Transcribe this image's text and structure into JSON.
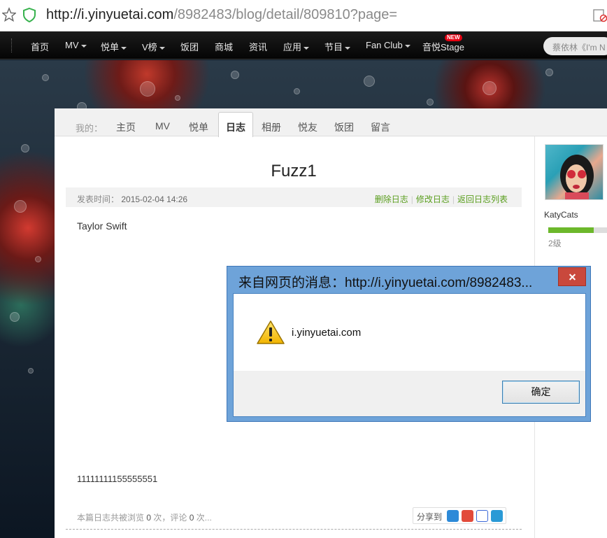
{
  "browser": {
    "url_host": "http://i.yinyuetai.com",
    "url_path": "/8982483/blog/detail/809810?page="
  },
  "topnav": {
    "items": [
      {
        "label": "首页"
      },
      {
        "label": "MV"
      },
      {
        "label": "悦单"
      },
      {
        "label": "V榜"
      },
      {
        "label": "饭团"
      },
      {
        "label": "商城"
      },
      {
        "label": "资讯"
      },
      {
        "label": "应用"
      },
      {
        "label": "节目"
      },
      {
        "label": "Fan Club"
      },
      {
        "label": "音悦Stage"
      }
    ],
    "new_badge": "NEW",
    "search_placeholder": "蔡依林《I'm N"
  },
  "subnav": {
    "label": "我的：",
    "tabs": [
      "主页",
      "MV",
      "悦单",
      "日志",
      "相册",
      "悦友",
      "饭团",
      "留言"
    ],
    "active_tab": "日志"
  },
  "blog": {
    "title": "Fuzz1",
    "date_label": "发表时间：",
    "date_value": "2015-02-04 14:26",
    "actions": [
      "删除日志",
      "修改日志",
      "返回日志列表"
    ],
    "body_line1": "Taylor Swift",
    "body_line2": "11111111155555551",
    "stats_prefix": "本篇日志共被浏览",
    "view_count": "0",
    "stats_mid": "次，评论",
    "comment_count": "0",
    "stats_suffix": "次...",
    "share_label": "分享到"
  },
  "sidebar": {
    "username": "KatyCats",
    "level_label": "2级",
    "level_progress": 0.72
  },
  "dialog": {
    "title": "来自网页的消息：http://i.yinyuetai.com/8982483...",
    "message": "i.yinyuetai.com",
    "ok_label": "确定"
  },
  "colors": {
    "accent_green": "#5a9e1e",
    "dialog_frame": "#6ea3d9",
    "close_red": "#c9483c",
    "new_badge": "#e60012"
  }
}
